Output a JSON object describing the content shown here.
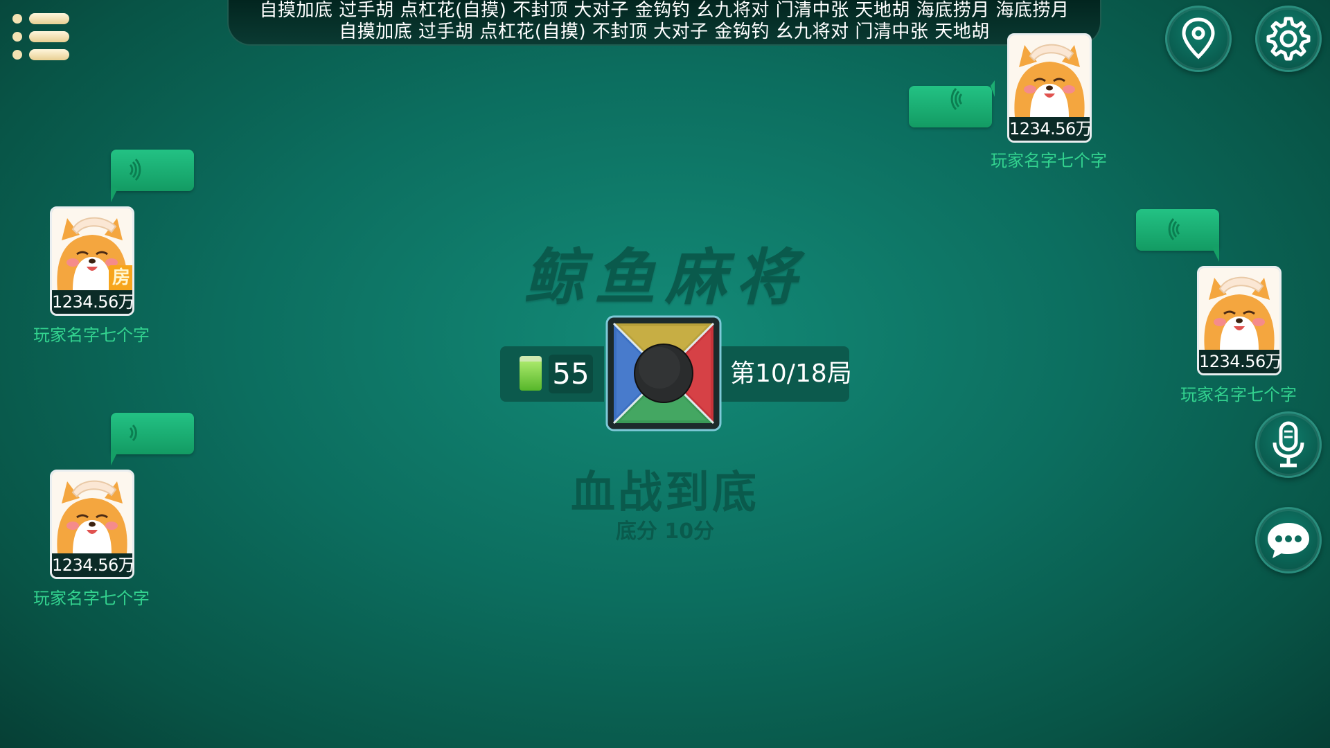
{
  "rules_banner": {
    "line1": "自摸加底  过手胡  点杠花(自摸)  不封顶  大对子  金钩钓  幺九将对  门清中张  天地胡  海底捞月  海底捞月",
    "line2": "自摸加底  过手胡  点杠花(自摸)  不封顶  大对子  金钩钓  幺九将对  门清中张  天地胡"
  },
  "board": {
    "game_title": "鲸鱼麻将",
    "tiles_remaining": "55",
    "round_label": "第10/18局",
    "mode_title": "血战到底",
    "base_score": "底分 10分"
  },
  "players": {
    "top_right": {
      "score": "1234.56万",
      "name": "玩家名字七个字"
    },
    "right": {
      "score": "1234.56万",
      "name": "玩家名字七个字"
    },
    "left_host": {
      "score": "1234.56万",
      "name": "玩家名字七个字",
      "host_badge": "房"
    },
    "left_bottom": {
      "score": "1234.56万",
      "name": "玩家名字七个字"
    }
  },
  "icons": {
    "menu": "menu-icon",
    "location": "location-pin-icon",
    "settings": "gear-icon",
    "voice_mic": "microphone-icon",
    "chat": "chat-bubble-icon"
  },
  "colors": {
    "table_felt": "#0c6e5f",
    "player_name": "#33d38f",
    "voice_bubble": "#1aae70",
    "host_badge": "#f7a51c"
  }
}
